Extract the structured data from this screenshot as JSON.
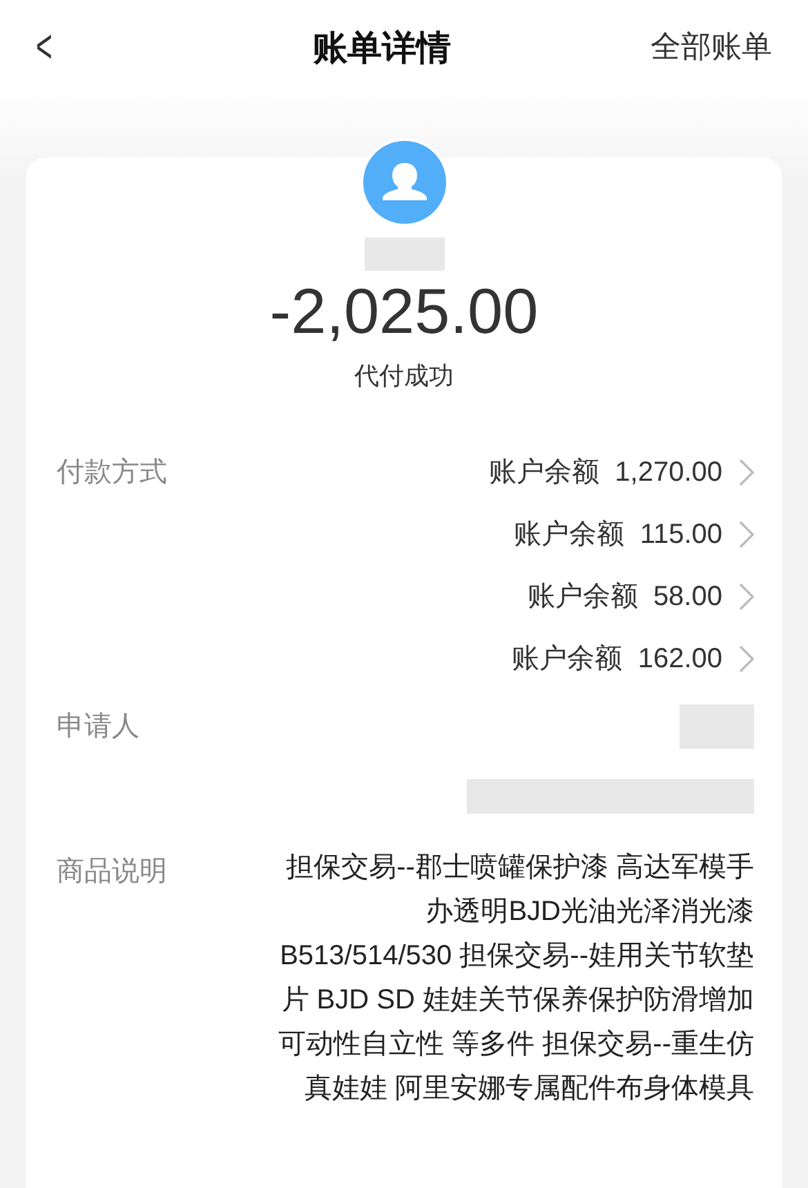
{
  "header": {
    "back": "<",
    "title": "账单详情",
    "action": "全部账单"
  },
  "summary": {
    "amount": "-2,025.00",
    "status": "代付成功"
  },
  "payment": {
    "label": "付款方式",
    "methods": [
      {
        "name": "账户余额",
        "amount": "1,270.00"
      },
      {
        "name": "账户余额",
        "amount": "115.00"
      },
      {
        "name": "账户余额",
        "amount": "58.00"
      },
      {
        "name": "账户余额",
        "amount": "162.00"
      }
    ]
  },
  "applicant": {
    "label": "申请人"
  },
  "description": {
    "label": "商品说明",
    "lines": [
      "担保交易--郡士喷罐保护漆 高达军模手",
      "办透明BJD光油光泽消光漆",
      "B513/514/530 担保交易--娃用关节软垫",
      "片 BJD SD 娃娃关节保养保护防滑增加",
      "可动性自立性 等多件 担保交易--重生仿",
      "真娃娃 阿里安娜专属配件布身体模具"
    ]
  }
}
